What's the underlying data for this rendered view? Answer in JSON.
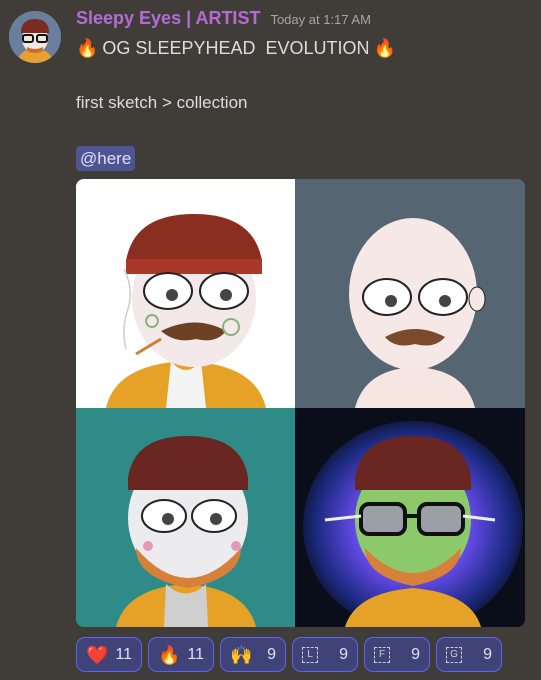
{
  "author": {
    "name": "Sleepy Eyes | ARTIST",
    "timestamp": "Today at 1:17 AM"
  },
  "message": {
    "title_emoji_left": "🔥",
    "title": "OG SLEEPYHEAD  EVOLUTION",
    "title_emoji_right": "🔥",
    "subtitle": "first sketch > collection",
    "mention": "@here"
  },
  "images": [
    {
      "name": "first-sketch",
      "bg": "#ffffff"
    },
    {
      "name": "bald-version",
      "bg": "#566572"
    },
    {
      "name": "teal-version",
      "bg": "#2e8b87"
    },
    {
      "name": "cosmic-version",
      "bg": "#0a0d1a"
    }
  ],
  "reactions": [
    {
      "emoji": "❤️",
      "count": "11"
    },
    {
      "emoji": "🔥",
      "count": "11"
    },
    {
      "emoji": "🙌",
      "count": "9"
    },
    {
      "emoji": "L",
      "count": "9",
      "letter": true
    },
    {
      "emoji": "F",
      "count": "9",
      "letter": true
    },
    {
      "emoji": "G",
      "count": "9",
      "letter": true
    }
  ],
  "colors": {
    "background": "#403d38",
    "username": "#b46bd6",
    "mention_bg": "#4e5592",
    "reaction_border": "#5865f2",
    "reaction_bg": "#3f4377"
  }
}
